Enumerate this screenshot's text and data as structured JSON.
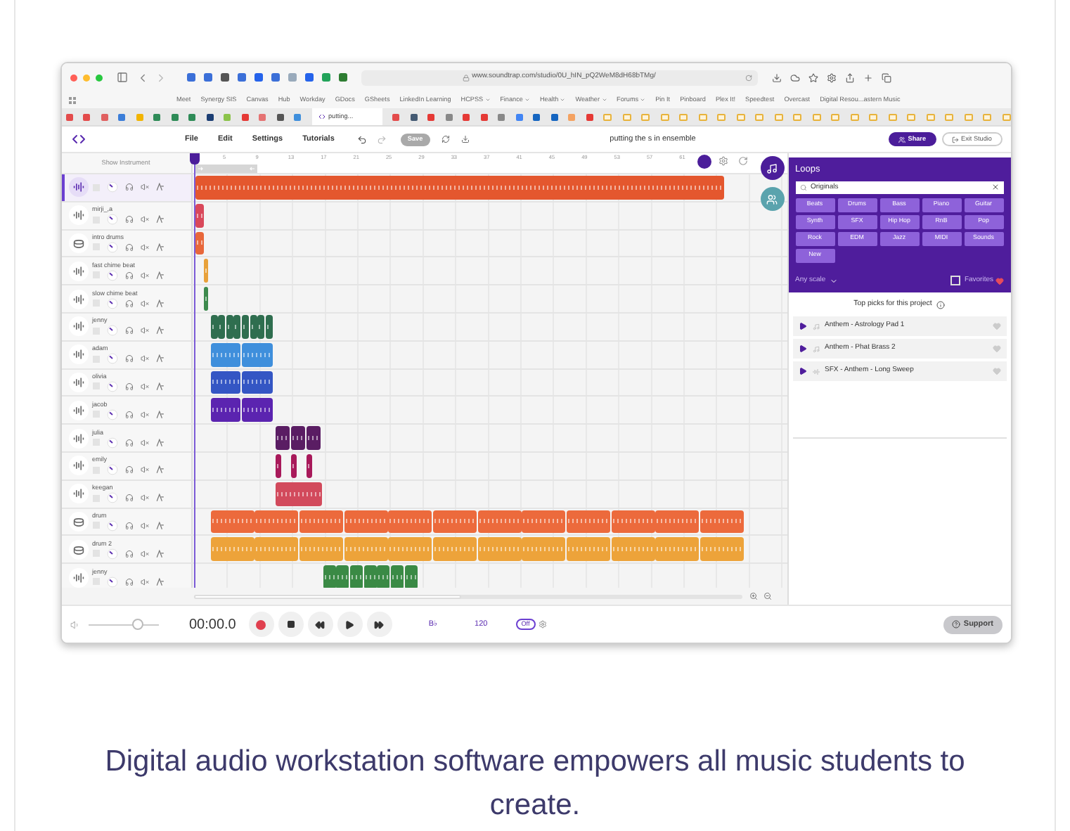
{
  "browser": {
    "url": "www.soundtrap.com/studio/0U_hIN_pQ2WeM8dH68bTMg/",
    "bookmarks": [
      {
        "label": "Meet",
        "dropdown": false
      },
      {
        "label": "Synergy SIS",
        "dropdown": false
      },
      {
        "label": "Canvas",
        "dropdown": false
      },
      {
        "label": "Hub",
        "dropdown": false
      },
      {
        "label": "Workday",
        "dropdown": false
      },
      {
        "label": "GDocs",
        "dropdown": false
      },
      {
        "label": "GSheets",
        "dropdown": false
      },
      {
        "label": "LinkedIn Learning",
        "dropdown": false
      },
      {
        "label": "HCPSS",
        "dropdown": true
      },
      {
        "label": "Finance",
        "dropdown": true
      },
      {
        "label": "Health",
        "dropdown": true
      },
      {
        "label": "Weather",
        "dropdown": true
      },
      {
        "label": "Forums",
        "dropdown": true
      },
      {
        "label": "Pin It",
        "dropdown": false
      },
      {
        "label": "Pinboard",
        "dropdown": false
      },
      {
        "label": "Plex It!",
        "dropdown": false
      },
      {
        "label": "Speedtest",
        "dropdown": false
      },
      {
        "label": "Overcast",
        "dropdown": false
      },
      {
        "label": "Digital Resou...astern Music",
        "dropdown": false
      }
    ],
    "active_tab": "putting..."
  },
  "app": {
    "menu": [
      "File",
      "Edit",
      "Settings",
      "Tutorials"
    ],
    "save": {
      "label": "Save",
      "disabled": true
    },
    "project_title": "putting the s in ensemble",
    "share": "Share",
    "exit": "Exit Studio"
  },
  "show_instrument": "Show Instrument",
  "ruler": [
    "5",
    "9",
    "13",
    "17",
    "21",
    "25",
    "29",
    "33",
    "37",
    "41",
    "45",
    "49",
    "53",
    "57",
    "61"
  ],
  "tracks": [
    {
      "kind": "audio",
      "selected": true,
      "color": "#e4572e"
    },
    {
      "name": "mirji_,a",
      "kind": "audio",
      "selected": false,
      "color": "#d9485a"
    },
    {
      "name": "intro drums",
      "kind": "drums",
      "selected": false,
      "color": "#e8673a"
    },
    {
      "name": "fast chime beat",
      "kind": "audio",
      "selected": false,
      "color": "#e8a13a"
    },
    {
      "name": "slow chime beat",
      "kind": "audio",
      "selected": false,
      "color": "#3d8a4d"
    },
    {
      "name": "jenny",
      "kind": "audio",
      "selected": false,
      "color": "#2f6e4f"
    },
    {
      "name": "adam",
      "kind": "audio",
      "selected": false,
      "color": "#3f8fdc"
    },
    {
      "name": "olivia",
      "kind": "audio",
      "selected": false,
      "color": "#3456c4"
    },
    {
      "name": "jacob",
      "kind": "audio",
      "selected": false,
      "color": "#5b24b0"
    },
    {
      "name": "julia",
      "kind": "audio",
      "selected": false,
      "color": "#5a1d63"
    },
    {
      "name": "emily",
      "kind": "audio",
      "selected": false,
      "color": "#a8195a"
    },
    {
      "name": "keegan",
      "kind": "audio",
      "selected": false,
      "color": "#d24a5c"
    },
    {
      "name": "drum",
      "kind": "drums",
      "selected": false,
      "color": "#ec6a3c"
    },
    {
      "name": "drum 2",
      "kind": "drums",
      "selected": false,
      "color": "#eda33a"
    },
    {
      "name": "jenny",
      "kind": "audio",
      "selected": false,
      "color": "#3a8a45"
    }
  ],
  "loops": {
    "title": "Loops",
    "search": "Originals",
    "tags": [
      "Beats",
      "Drums",
      "Bass",
      "Piano",
      "Guitar",
      "Synth",
      "SFX",
      "Hip Hop",
      "RnB",
      "Pop",
      "Rock",
      "EDM",
      "Jazz",
      "MIDI",
      "Sounds",
      "New"
    ],
    "scale": "Any scale",
    "favorites": {
      "label": "Favorites",
      "checked": false
    },
    "top_picks": "Top picks for this project",
    "items": [
      {
        "name": "Anthem - Astrology Pad 1",
        "kind": "instrument"
      },
      {
        "name": "Anthem - Phat Brass 2",
        "kind": "instrument"
      },
      {
        "name": "SFX - Anthem - Long Sweep",
        "kind": "audio"
      }
    ]
  },
  "transport": {
    "volume": {
      "level": 0.7
    },
    "time": "00:00.0",
    "key": "B♭",
    "tempo": "120",
    "metronome": "Off",
    "support": "Support"
  },
  "caption": "Digital audio workstation software empowers all music students to create."
}
